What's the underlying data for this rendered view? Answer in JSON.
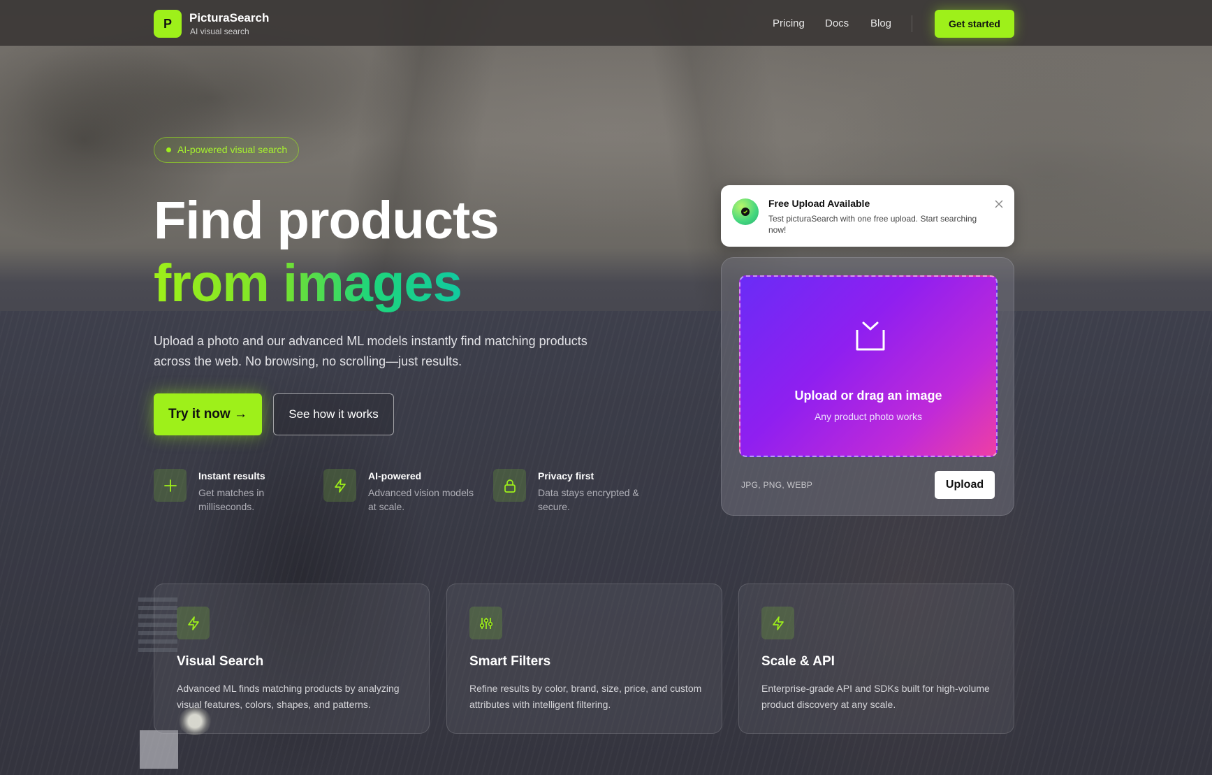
{
  "header": {
    "logo_letter": "P",
    "brand": "PicturaSearch",
    "tagline": "AI visual search",
    "nav": [
      "Pricing",
      "Docs",
      "Blog"
    ],
    "cta": "Get started"
  },
  "hero": {
    "badge": "AI-powered visual search",
    "title_line1": "Find products",
    "title_line2": "from images",
    "lead": "Upload a photo and our advanced ML models instantly find matching products across the web. No browsing, no scrolling—just results.",
    "primary_button": "Try it now →",
    "secondary_button": "See how it works",
    "features": [
      {
        "icon": "plus-icon",
        "title": "Instant results",
        "desc": "Get matches in milliseconds."
      },
      {
        "icon": "lightning-icon",
        "title": "AI-powered",
        "desc": "Advanced vision models at scale."
      },
      {
        "icon": "lock-icon",
        "title": "Privacy first",
        "desc": "Data stays encrypted & secure."
      }
    ]
  },
  "notification": {
    "title": "Free Upload Available",
    "body": "Test picturaSearch with one free upload. Start searching now!"
  },
  "upload": {
    "title": "Upload or drag an image",
    "subtitle": "Any product photo works",
    "formats": "JPG, PNG, WEBP",
    "button": "Upload"
  },
  "cards": [
    {
      "icon": "lightning-icon",
      "title": "Visual Search",
      "desc": "Advanced ML finds matching products by analyzing visual features, colors, shapes, and patterns."
    },
    {
      "icon": "sliders-icon",
      "title": "Smart Filters",
      "desc": "Refine results by color, brand, size, price, and custom attributes with intelligent filtering."
    },
    {
      "icon": "lightning-icon",
      "title": "Scale & API",
      "desc": "Enterprise-grade API and SDKs built for high-volume product discovery at any scale."
    }
  ],
  "colors": {
    "accent": "#9ef01a",
    "gradient_start": "#6a2cf6",
    "gradient_end": "#ee3fa4"
  }
}
